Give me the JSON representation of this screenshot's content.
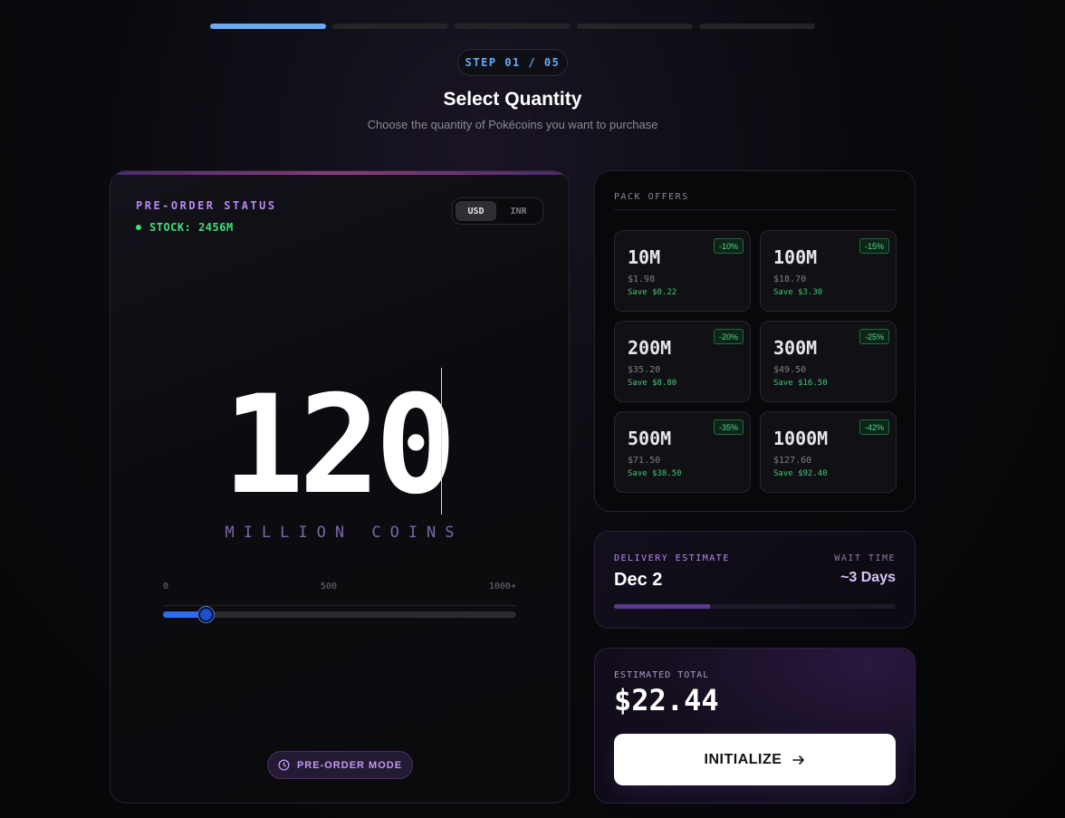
{
  "progress": {
    "total_steps": 5,
    "current_step": 1
  },
  "step_pill": "STEP 01 / 05",
  "header": {
    "title": "Select Quantity",
    "subtitle": "Choose the quantity of Pokécoins you want to purchase"
  },
  "quantity_card": {
    "status_label": "PRE-ORDER STATUS",
    "stock": "STOCK: 2456M",
    "currency_options": [
      "USD",
      "INR"
    ],
    "currency_selected": "USD",
    "quantity": "120",
    "units": "MILLION COINS",
    "slider": {
      "min_label": "0",
      "mid_label": "500",
      "max_label": "1000+",
      "value": 120,
      "max": 1000
    },
    "preorder_label": "PRE-ORDER MODE"
  },
  "offers": {
    "title": "PACK OFFERS",
    "items": [
      {
        "qty": "10M",
        "price": "$1.98",
        "save": "Save $0.22",
        "badge": "-10%"
      },
      {
        "qty": "100M",
        "price": "$18.70",
        "save": "Save $3.30",
        "badge": "-15%"
      },
      {
        "qty": "200M",
        "price": "$35.20",
        "save": "Save $8.80",
        "badge": "-20%"
      },
      {
        "qty": "300M",
        "price": "$49.50",
        "save": "Save $16.50",
        "badge": "-25%"
      },
      {
        "qty": "500M",
        "price": "$71.50",
        "save": "Save $38.50",
        "badge": "-35%"
      },
      {
        "qty": "1000M",
        "price": "$127.60",
        "save": "Save $92.40",
        "badge": "-42%"
      }
    ]
  },
  "delivery": {
    "label": "DELIVERY ESTIMATE",
    "date": "Dec 2",
    "wait_label": "WAIT TIME",
    "wait_value": "~3 Days",
    "progress": 0.34
  },
  "total": {
    "label": "ESTIMATED TOTAL",
    "value": "$22.44",
    "button_label": "INITIALIZE"
  },
  "colors": {
    "accent_blue": "#6aa9f0",
    "accent_purple": "#b88af0",
    "success_green": "#3ee07a"
  },
  "icons": {
    "preorder": "clock-icon",
    "initialize": "arrow-right-icon"
  }
}
